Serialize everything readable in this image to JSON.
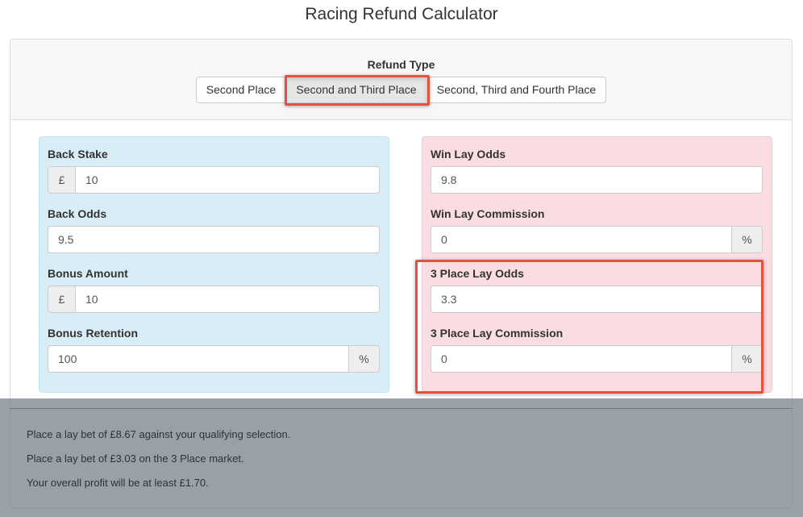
{
  "title": "Racing Refund Calculator",
  "refund_type": {
    "label": "Refund Type",
    "options": [
      "Second Place",
      "Second and Third Place",
      "Second, Third and Fourth Place"
    ],
    "selected": "Second and Third Place"
  },
  "back": {
    "stake_label": "Back Stake",
    "stake_prefix": "£",
    "stake_value": "10",
    "odds_label": "Back Odds",
    "odds_value": "9.5",
    "bonus_label": "Bonus Amount",
    "bonus_prefix": "£",
    "bonus_value": "10",
    "retention_label": "Bonus Retention",
    "retention_value": "100",
    "retention_suffix": "%"
  },
  "lay": {
    "win_odds_label": "Win Lay Odds",
    "win_odds_value": "9.8",
    "win_commission_label": "Win Lay Commission",
    "win_commission_value": "0",
    "win_commission_suffix": "%",
    "place_odds_label": "3 Place Lay Odds",
    "place_odds_value": "3.3",
    "place_commission_label": "3 Place Lay Commission",
    "place_commission_value": "0",
    "place_commission_suffix": "%"
  },
  "results": [
    "Place a lay bet of £8.67 against your qualifying selection.",
    "Place a lay bet of £3.03 on the 3 Place market.",
    "Your overall profit will be at least £1.70."
  ],
  "colors": {
    "back_panel": "#d9edf7",
    "lay_panel": "#f9dde2",
    "highlight": "#e0533f"
  }
}
